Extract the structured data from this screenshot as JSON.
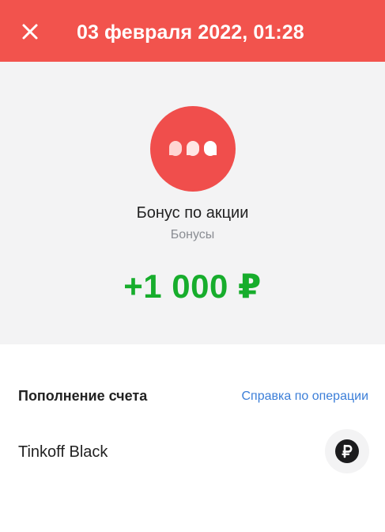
{
  "header": {
    "title": "03 февраля 2022, 01:28",
    "close_icon": "close-icon",
    "background_color": "#f2534d"
  },
  "hero": {
    "icon": "chat-bubbles-icon",
    "icon_color": "#f04e4c",
    "title": "Бонус по акции",
    "subtitle": "Бонусы",
    "amount": "+1 000 ₽",
    "amount_color": "#17ad2c"
  },
  "details": {
    "section_title": "Пополнение счета",
    "help_link": "Справка по операции",
    "help_link_color": "#3b7ed8",
    "account_name": "Tinkoff Black",
    "account_icon": "ruble-icon"
  }
}
